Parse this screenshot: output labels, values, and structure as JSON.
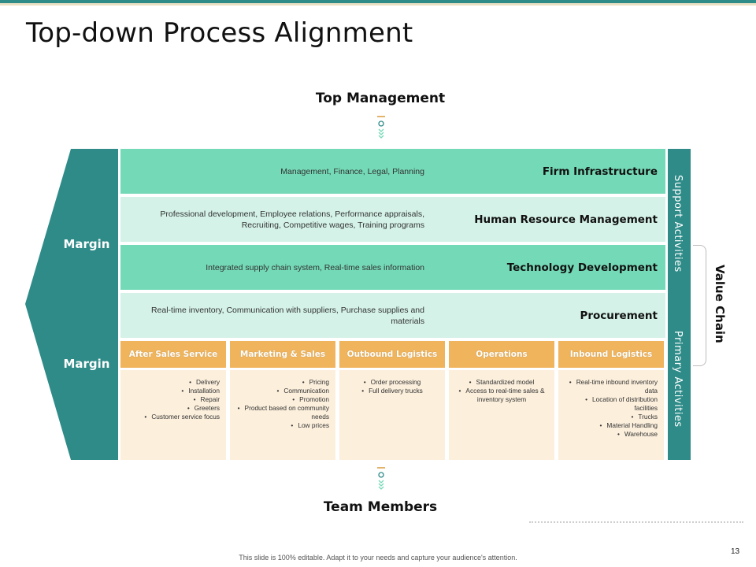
{
  "title": "Top-down Process Alignment",
  "top_label": "Top Management",
  "bottom_label": "Team Members",
  "margin_labels": [
    "Margin",
    "Margin"
  ],
  "support_activities": [
    {
      "name": "Firm Infrastructure",
      "description": "Management, Finance, Legal, Planning"
    },
    {
      "name": "Human Resource Management",
      "description": "Professional development, Employee relations, Performance appraisals, Recruiting, Competitive wages, Training programs"
    },
    {
      "name": "Technology Development",
      "description": "Integrated supply chain system, Real-time sales information"
    },
    {
      "name": "Procurement",
      "description": "Real-time inventory, Communication with suppliers, Purchase supplies and materials"
    }
  ],
  "primary_activities": [
    {
      "name": "After Sales Service",
      "items": [
        "Delivery",
        "Installation",
        "Repair",
        "Greeters",
        "Customer service focus"
      ]
    },
    {
      "name": "Marketing & Sales",
      "items": [
        "Pricing",
        "Communication",
        "Promotion",
        "Product based on community needs",
        "Low prices"
      ]
    },
    {
      "name": "Outbound Logistics",
      "items": [
        "Order processing",
        "Full delivery trucks"
      ]
    },
    {
      "name": "Operations",
      "items": [
        "Standardized model",
        "Access to real-time sales & inventory system"
      ]
    },
    {
      "name": "Inbound Logistics",
      "items": [
        "Real-time inbound inventory data",
        "Location of distribution facilities",
        "Trucks",
        "Material Handling",
        "Warehouse"
      ]
    }
  ],
  "side_labels": {
    "support": "Support Activities",
    "primary": "Primary Activities",
    "value_chain": "Value Chain"
  },
  "footer": "This slide is 100% editable. Adapt it to your needs and capture your audience's attention.",
  "page_number": "13",
  "colors": {
    "teal": "#2e8b88",
    "mint_dark": "#74d9b6",
    "mint_light": "#d4f2e7",
    "orange": "#efb45c",
    "cream": "#fcefdc"
  }
}
